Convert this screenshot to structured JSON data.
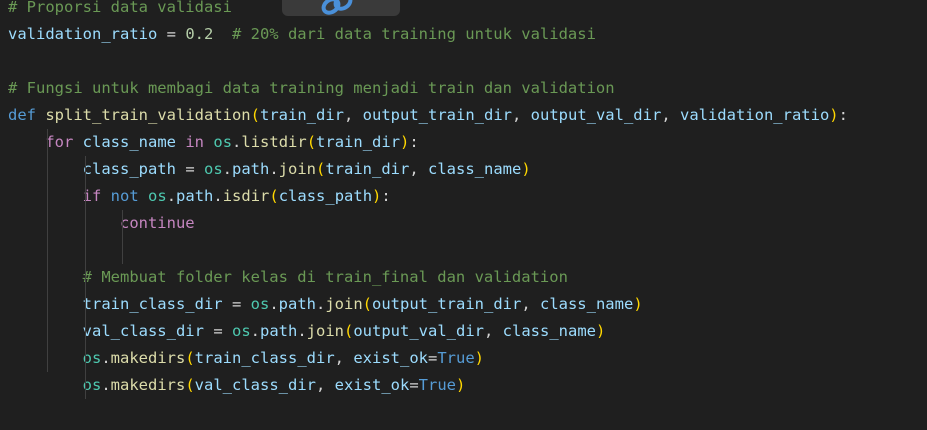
{
  "editor": {
    "lines": [
      {
        "segments": [
          {
            "c": "cm",
            "t": "# Proporsi data validasi"
          }
        ]
      },
      {
        "segments": [
          {
            "c": "var",
            "t": "validation_ratio"
          },
          {
            "c": "op",
            "t": " = "
          },
          {
            "c": "num",
            "t": "0.2"
          },
          {
            "c": "op",
            "t": "  "
          },
          {
            "c": "cm",
            "t": "# 20% dari data training untuk validasi"
          }
        ]
      },
      {
        "segments": []
      },
      {
        "segments": [
          {
            "c": "cm",
            "t": "# Fungsi untuk membagi data training menjadi train dan validation"
          }
        ]
      },
      {
        "segments": [
          {
            "c": "def",
            "t": "def"
          },
          {
            "c": "op",
            "t": " "
          },
          {
            "c": "fn",
            "t": "split_train_validation"
          },
          {
            "c": "p1",
            "t": "("
          },
          {
            "c": "var",
            "t": "train_dir"
          },
          {
            "c": "op",
            "t": ", "
          },
          {
            "c": "var",
            "t": "output_train_dir"
          },
          {
            "c": "op",
            "t": ", "
          },
          {
            "c": "var",
            "t": "output_val_dir"
          },
          {
            "c": "op",
            "t": ", "
          },
          {
            "c": "var",
            "t": "validation_ratio"
          },
          {
            "c": "p1",
            "t": ")"
          },
          {
            "c": "op",
            "t": ":"
          }
        ]
      },
      {
        "segments": [
          {
            "c": "op",
            "t": "    "
          },
          {
            "c": "kw",
            "t": "for"
          },
          {
            "c": "op",
            "t": " "
          },
          {
            "c": "var",
            "t": "class_name"
          },
          {
            "c": "op",
            "t": " "
          },
          {
            "c": "kw",
            "t": "in"
          },
          {
            "c": "op",
            "t": " "
          },
          {
            "c": "mod",
            "t": "os"
          },
          {
            "c": "op",
            "t": "."
          },
          {
            "c": "fn",
            "t": "listdir"
          },
          {
            "c": "p1",
            "t": "("
          },
          {
            "c": "var",
            "t": "train_dir"
          },
          {
            "c": "p1",
            "t": ")"
          },
          {
            "c": "op",
            "t": ":"
          }
        ]
      },
      {
        "segments": [
          {
            "c": "op",
            "t": "        "
          },
          {
            "c": "var",
            "t": "class_path"
          },
          {
            "c": "op",
            "t": " = "
          },
          {
            "c": "mod",
            "t": "os"
          },
          {
            "c": "op",
            "t": "."
          },
          {
            "c": "var",
            "t": "path"
          },
          {
            "c": "op",
            "t": "."
          },
          {
            "c": "fn",
            "t": "join"
          },
          {
            "c": "p1",
            "t": "("
          },
          {
            "c": "var",
            "t": "train_dir"
          },
          {
            "c": "op",
            "t": ", "
          },
          {
            "c": "var",
            "t": "class_name"
          },
          {
            "c": "p1",
            "t": ")"
          }
        ]
      },
      {
        "segments": [
          {
            "c": "op",
            "t": "        "
          },
          {
            "c": "kw",
            "t": "if"
          },
          {
            "c": "op",
            "t": " "
          },
          {
            "c": "def",
            "t": "not"
          },
          {
            "c": "op",
            "t": " "
          },
          {
            "c": "mod",
            "t": "os"
          },
          {
            "c": "op",
            "t": "."
          },
          {
            "c": "var",
            "t": "path"
          },
          {
            "c": "op",
            "t": "."
          },
          {
            "c": "fn",
            "t": "isdir"
          },
          {
            "c": "p1",
            "t": "("
          },
          {
            "c": "var",
            "t": "class_path"
          },
          {
            "c": "p1",
            "t": ")"
          },
          {
            "c": "op",
            "t": ":"
          }
        ]
      },
      {
        "segments": [
          {
            "c": "op",
            "t": "            "
          },
          {
            "c": "kw",
            "t": "continue"
          }
        ]
      },
      {
        "segments": []
      },
      {
        "segments": [
          {
            "c": "op",
            "t": "        "
          },
          {
            "c": "cm",
            "t": "# Membuat folder kelas di train_final dan validation"
          }
        ]
      },
      {
        "segments": [
          {
            "c": "op",
            "t": "        "
          },
          {
            "c": "var",
            "t": "train_class_dir"
          },
          {
            "c": "op",
            "t": " = "
          },
          {
            "c": "mod",
            "t": "os"
          },
          {
            "c": "op",
            "t": "."
          },
          {
            "c": "var",
            "t": "path"
          },
          {
            "c": "op",
            "t": "."
          },
          {
            "c": "fn",
            "t": "join"
          },
          {
            "c": "p1",
            "t": "("
          },
          {
            "c": "var",
            "t": "output_train_dir"
          },
          {
            "c": "op",
            "t": ", "
          },
          {
            "c": "var",
            "t": "class_name"
          },
          {
            "c": "p1",
            "t": ")"
          }
        ]
      },
      {
        "segments": [
          {
            "c": "op",
            "t": "        "
          },
          {
            "c": "var",
            "t": "val_class_dir"
          },
          {
            "c": "op",
            "t": " = "
          },
          {
            "c": "mod",
            "t": "os"
          },
          {
            "c": "op",
            "t": "."
          },
          {
            "c": "var",
            "t": "path"
          },
          {
            "c": "op",
            "t": "."
          },
          {
            "c": "fn",
            "t": "join"
          },
          {
            "c": "p1",
            "t": "("
          },
          {
            "c": "var",
            "t": "output_val_dir"
          },
          {
            "c": "op",
            "t": ", "
          },
          {
            "c": "var",
            "t": "class_name"
          },
          {
            "c": "p1",
            "t": ")"
          }
        ]
      },
      {
        "segments": [
          {
            "c": "op",
            "t": "        "
          },
          {
            "c": "mod",
            "t": "os"
          },
          {
            "c": "op",
            "t": "."
          },
          {
            "c": "fn",
            "t": "makedirs"
          },
          {
            "c": "p1",
            "t": "("
          },
          {
            "c": "var",
            "t": "train_class_dir"
          },
          {
            "c": "op",
            "t": ", "
          },
          {
            "c": "var",
            "t": "exist_ok"
          },
          {
            "c": "op",
            "t": "="
          },
          {
            "c": "def",
            "t": "True"
          },
          {
            "c": "p1",
            "t": ")"
          }
        ]
      },
      {
        "segments": [
          {
            "c": "op",
            "t": "        "
          },
          {
            "c": "mod",
            "t": "os"
          },
          {
            "c": "op",
            "t": "."
          },
          {
            "c": "fn",
            "t": "makedirs"
          },
          {
            "c": "p1",
            "t": "("
          },
          {
            "c": "var",
            "t": "val_class_dir"
          },
          {
            "c": "op",
            "t": ", "
          },
          {
            "c": "var",
            "t": "exist_ok"
          },
          {
            "c": "op",
            "t": "="
          },
          {
            "c": "def",
            "t": "True"
          },
          {
            "c": "p1",
            "t": ")"
          }
        ]
      }
    ]
  },
  "overlay": {
    "icon": "link-icon"
  },
  "colors": {
    "background": "#1f1f1f",
    "comment": "#6a9955",
    "keyword": "#c586c0",
    "function": "#dcdcaa",
    "variable": "#9cdcfe",
    "number": "#b5cea8",
    "bracket": "#ffd700"
  }
}
